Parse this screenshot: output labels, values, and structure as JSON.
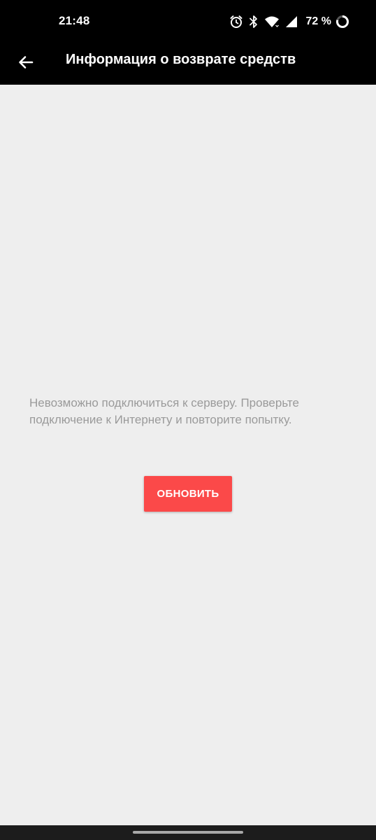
{
  "status_bar": {
    "time": "21:48",
    "battery_percent": "72 %",
    "icons": [
      "alarm-icon",
      "bluetooth-icon",
      "wifi-icon",
      "cellular-signal-icon",
      "battery-ring-icon"
    ]
  },
  "app_bar": {
    "title": "Информация о возврате средств",
    "back_icon": "arrow-left-icon"
  },
  "content": {
    "error_message": "Невозможно подключиться к серверу. Проверьте подключение к Интернету и повторите попытку.",
    "refresh_button_label": "ОБНОВИТЬ"
  },
  "colors": {
    "bar_background": "#000000",
    "content_background": "#eeeeee",
    "message_text": "#9a9a9a",
    "accent_button": "#fb4949"
  }
}
